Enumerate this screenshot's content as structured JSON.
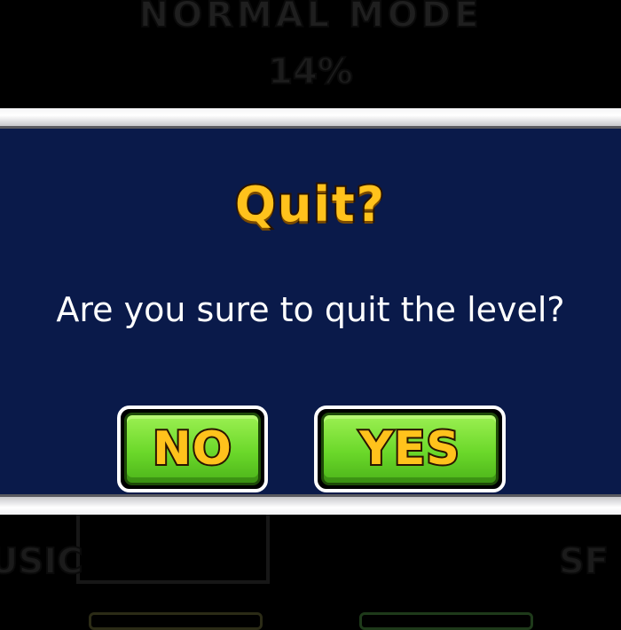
{
  "background": {
    "mode_title": "Normal Mode",
    "progress_text": "14%",
    "music_label_partial": "usic",
    "sfx_label_partial": "SF"
  },
  "dialog": {
    "title": "Quit?",
    "message": "Are you sure to quit the level?",
    "no_label": "No",
    "yes_label": "Yes"
  },
  "colors": {
    "panel_bg": "#0a1a4a",
    "title_gold": "#ffc21c",
    "button_green": "#6bd82a"
  }
}
